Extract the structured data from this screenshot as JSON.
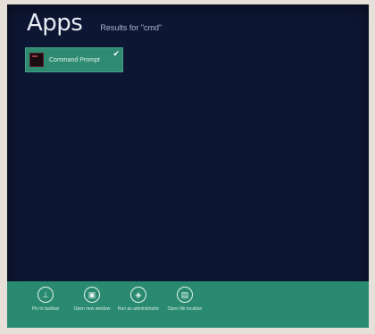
{
  "header": {
    "title": "Apps",
    "subtitle": "Results for \"cmd\""
  },
  "results": [
    {
      "label": "Command Prompt",
      "selected": true,
      "icon": "command-prompt-icon"
    }
  ],
  "app_bar": {
    "commands": [
      {
        "label": "Pin to taskbar",
        "icon": "pin-icon"
      },
      {
        "label": "Open new window",
        "icon": "new-window-icon"
      },
      {
        "label": "Run as administrator",
        "icon": "shield-icon"
      },
      {
        "label": "Open file location",
        "icon": "folder-icon"
      }
    ]
  },
  "colors": {
    "background": "#0d1633",
    "accent": "#2a8a70",
    "tile": "#2f8a72"
  }
}
